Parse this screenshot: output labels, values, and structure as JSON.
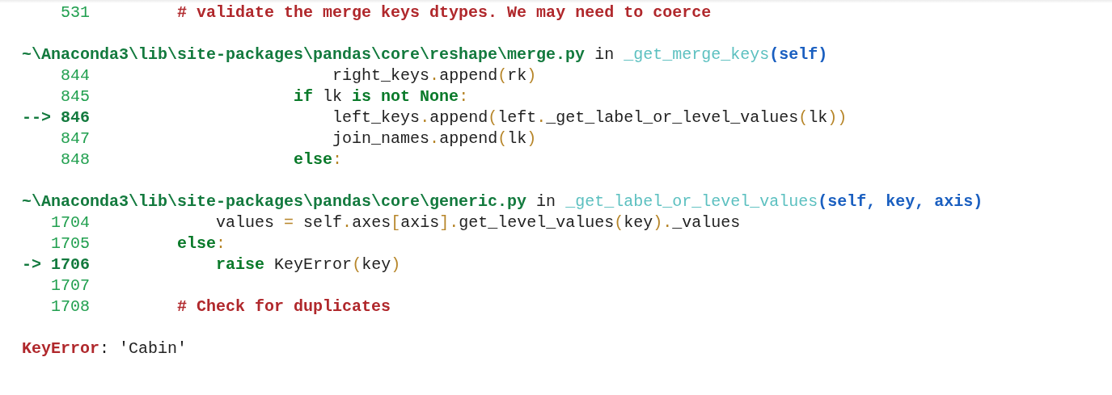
{
  "traceback": [
    {
      "kind": "code",
      "number": "531",
      "current": false,
      "tokens": [
        {
          "kind": "comment",
          "text": "         # validate the merge keys dtypes. We may need to coerce"
        }
      ]
    },
    {
      "kind": "blank"
    },
    {
      "kind": "header",
      "tokens": [
        {
          "kind": "path",
          "text": "~\\Anaconda3\\lib\\site-packages\\pandas\\core\\reshape\\merge.py"
        },
        {
          "kind": "plain",
          "text": " in "
        },
        {
          "kind": "func",
          "text": "_get_merge_keys"
        },
        {
          "kind": "args",
          "text": "(self)"
        }
      ]
    },
    {
      "kind": "code",
      "number": "844",
      "current": false,
      "tokens": [
        {
          "kind": "plain",
          "text": "                         right_keys"
        },
        {
          "kind": "op",
          "text": "."
        },
        {
          "kind": "plain",
          "text": "append"
        },
        {
          "kind": "op",
          "text": "("
        },
        {
          "kind": "plain",
          "text": "rk"
        },
        {
          "kind": "op",
          "text": ")"
        }
      ]
    },
    {
      "kind": "code",
      "number": "845",
      "current": false,
      "tokens": [
        {
          "kind": "keyword",
          "text": "                     if"
        },
        {
          "kind": "plain",
          "text": " lk "
        },
        {
          "kind": "keyword",
          "text": "is not None"
        },
        {
          "kind": "op",
          "text": ":"
        }
      ]
    },
    {
      "kind": "code",
      "number": "846",
      "current": true,
      "arrow": "-->",
      "tokens": [
        {
          "kind": "plain",
          "text": "                         left_keys"
        },
        {
          "kind": "op",
          "text": "."
        },
        {
          "kind": "plain",
          "text": "append"
        },
        {
          "kind": "op",
          "text": "("
        },
        {
          "kind": "plain",
          "text": "left"
        },
        {
          "kind": "op",
          "text": "."
        },
        {
          "kind": "plain",
          "text": "_get_label_or_level_values"
        },
        {
          "kind": "op",
          "text": "("
        },
        {
          "kind": "plain",
          "text": "lk"
        },
        {
          "kind": "op",
          "text": "))"
        }
      ]
    },
    {
      "kind": "code",
      "number": "847",
      "current": false,
      "tokens": [
        {
          "kind": "plain",
          "text": "                         join_names"
        },
        {
          "kind": "op",
          "text": "."
        },
        {
          "kind": "plain",
          "text": "append"
        },
        {
          "kind": "op",
          "text": "("
        },
        {
          "kind": "plain",
          "text": "lk"
        },
        {
          "kind": "op",
          "text": ")"
        }
      ]
    },
    {
      "kind": "code",
      "number": "848",
      "current": false,
      "tokens": [
        {
          "kind": "keyword",
          "text": "                     else"
        },
        {
          "kind": "op",
          "text": ":"
        }
      ]
    },
    {
      "kind": "blank"
    },
    {
      "kind": "header",
      "tokens": [
        {
          "kind": "path",
          "text": "~\\Anaconda3\\lib\\site-packages\\pandas\\core\\generic.py"
        },
        {
          "kind": "plain",
          "text": " in "
        },
        {
          "kind": "func",
          "text": "_get_label_or_level_values"
        },
        {
          "kind": "args",
          "text": "(self, key, axis)"
        }
      ]
    },
    {
      "kind": "code",
      "number": "1704",
      "current": false,
      "tokens": [
        {
          "kind": "plain",
          "text": "             values "
        },
        {
          "kind": "op",
          "text": "="
        },
        {
          "kind": "plain",
          "text": " self"
        },
        {
          "kind": "op",
          "text": "."
        },
        {
          "kind": "plain",
          "text": "axes"
        },
        {
          "kind": "op",
          "text": "["
        },
        {
          "kind": "plain",
          "text": "axis"
        },
        {
          "kind": "op",
          "text": "]."
        },
        {
          "kind": "plain",
          "text": "get_level_values"
        },
        {
          "kind": "op",
          "text": "("
        },
        {
          "kind": "plain",
          "text": "key"
        },
        {
          "kind": "op",
          "text": ")."
        },
        {
          "kind": "plain",
          "text": "_values"
        }
      ]
    },
    {
      "kind": "code",
      "number": "1705",
      "current": false,
      "tokens": [
        {
          "kind": "keyword",
          "text": "         else"
        },
        {
          "kind": "op",
          "text": ":"
        }
      ]
    },
    {
      "kind": "code",
      "number": "1706",
      "current": true,
      "arrow": "->",
      "tokens": [
        {
          "kind": "keyword",
          "text": "             raise"
        },
        {
          "kind": "plain",
          "text": " KeyError"
        },
        {
          "kind": "op",
          "text": "("
        },
        {
          "kind": "plain",
          "text": "key"
        },
        {
          "kind": "op",
          "text": ")"
        }
      ]
    },
    {
      "kind": "code",
      "number": "1707",
      "current": false
    },
    {
      "kind": "code",
      "number": "1708",
      "current": false,
      "tokens": [
        {
          "kind": "comment",
          "text": "         # Check for duplicates"
        }
      ]
    },
    {
      "kind": "blank"
    },
    {
      "kind": "error",
      "name": "KeyError",
      "message": ": 'Cabin'"
    }
  ]
}
